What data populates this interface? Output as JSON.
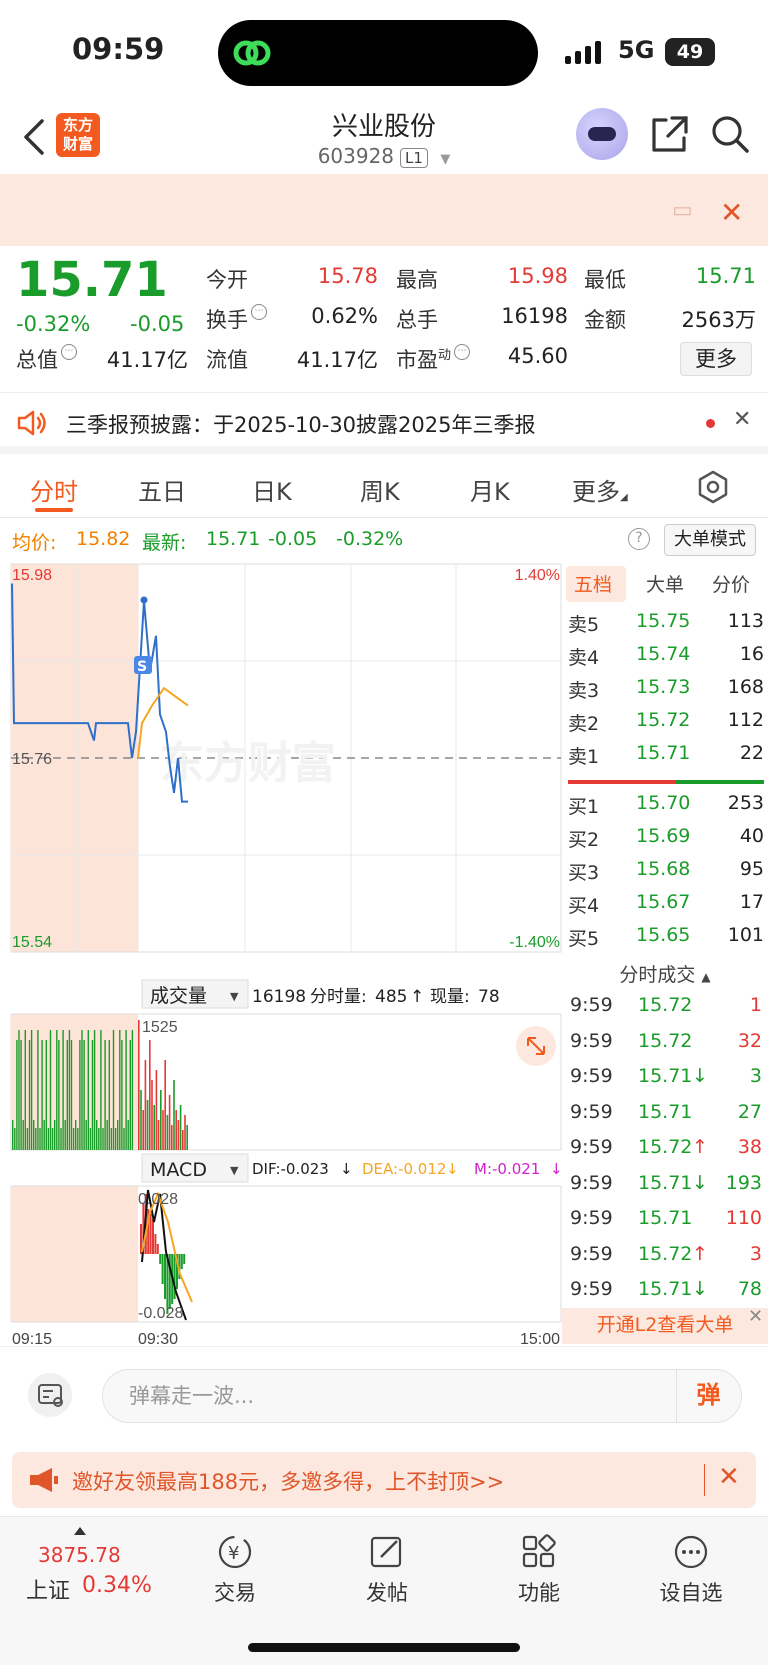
{
  "status_bar": {
    "time": "09:59",
    "network": "5G",
    "battery": "49"
  },
  "header": {
    "logo_text": "东方财富",
    "stock_name": "兴业股份",
    "stock_code": "603928",
    "level": "L1"
  },
  "quote": {
    "price": "15.71",
    "change_pct": "-0.32%",
    "change_amt": "-0.05",
    "fields": {
      "open_label": "今开",
      "open": "15.78",
      "high_label": "最高",
      "high": "15.98",
      "low_label": "最低",
      "low": "15.71",
      "turnover_label": "换手",
      "turnover": "0.62%",
      "volume_label": "总手",
      "volume": "16198",
      "amount_label": "金额",
      "amount": "2563万",
      "mktcap_label": "总值",
      "mktcap": "41.17亿",
      "float_label": "流值",
      "float": "41.17亿",
      "pe_label": "市盈",
      "pe_sup": "动",
      "pe": "45.60"
    },
    "more_label": "更多"
  },
  "notice": {
    "text": "三季报预披露：于2025-10-30披露2025年三季报"
  },
  "tabs": [
    "分时",
    "五日",
    "日K",
    "周K",
    "月K",
    "更多"
  ],
  "active_tab": 0,
  "info": {
    "avg_label": "均价:",
    "avg": "15.82",
    "latest_label": "最新:",
    "latest": "15.71",
    "latest_chg": "-0.05",
    "latest_pct": "-0.32%",
    "big_order_btn": "大单模式"
  },
  "chart": {
    "price_high": "15.98",
    "price_low": "15.54",
    "pct_high": "1.40%",
    "pct_low": "-1.40%",
    "prev_close": "15.76",
    "watermark": "东方财富",
    "volume_selector": "成交量",
    "volume_total": "16198",
    "volume_info_label": "分时量:",
    "volume_info": "485",
    "volume_now_label": "现量:",
    "volume_now": "78",
    "volume_max": "1525",
    "macd_selector": "MACD",
    "dif": "DIF:-0.023",
    "dea": "DEA:-0.012",
    "m": "M:-0.021",
    "macd_high": "0.028",
    "macd_low": "-0.028",
    "time_start": "09:15",
    "time_mid": "09:30",
    "time_end": "15:00"
  },
  "order_book": {
    "tabs": [
      "五档",
      "大单",
      "分价"
    ],
    "asks": [
      {
        "label": "卖5",
        "price": "15.75",
        "vol": "113"
      },
      {
        "label": "卖4",
        "price": "15.74",
        "vol": "16"
      },
      {
        "label": "卖3",
        "price": "15.73",
        "vol": "168"
      },
      {
        "label": "卖2",
        "price": "15.72",
        "vol": "112"
      },
      {
        "label": "卖1",
        "price": "15.71",
        "vol": "22"
      }
    ],
    "bids": [
      {
        "label": "买1",
        "price": "15.70",
        "vol": "253"
      },
      {
        "label": "买2",
        "price": "15.69",
        "vol": "40"
      },
      {
        "label": "买3",
        "price": "15.68",
        "vol": "95"
      },
      {
        "label": "买4",
        "price": "15.67",
        "vol": "17"
      },
      {
        "label": "买5",
        "price": "15.65",
        "vol": "101"
      }
    ]
  },
  "ticks": {
    "header": "分时成交",
    "rows": [
      {
        "time": "9:59",
        "price": "15.72",
        "arrow": "",
        "vol": "1",
        "color": "#e53935"
      },
      {
        "time": "9:59",
        "price": "15.72",
        "arrow": "",
        "vol": "32",
        "color": "#e53935"
      },
      {
        "time": "9:59",
        "price": "15.71",
        "arrow": "↓",
        "vol": "3",
        "color": "#1a9c2a"
      },
      {
        "time": "9:59",
        "price": "15.71",
        "arrow": "",
        "vol": "27",
        "color": "#1a9c2a"
      },
      {
        "time": "9:59",
        "price": "15.72",
        "arrow": "↑",
        "vol": "38",
        "color": "#e53935"
      },
      {
        "time": "9:59",
        "price": "15.71",
        "arrow": "↓",
        "vol": "193",
        "color": "#1a9c2a"
      },
      {
        "time": "9:59",
        "price": "15.71",
        "arrow": "",
        "vol": "110",
        "color": "#e53935"
      },
      {
        "time": "9:59",
        "price": "15.72",
        "arrow": "↑",
        "vol": "3",
        "color": "#e53935"
      },
      {
        "time": "9:59",
        "price": "15.71",
        "arrow": "↓",
        "vol": "78",
        "color": "#1a9c2a"
      }
    ],
    "l2_promo": "开通L2查看大单"
  },
  "comment": {
    "placeholder": "弹幕走一波...",
    "danmu": "弹"
  },
  "invite": {
    "text": "邀好友领最高188元，多邀多得，上不封顶>>"
  },
  "bottom_nav": {
    "index_value": "3875.78",
    "index_name": "上证",
    "index_pct": "0.34%",
    "items": [
      "交易",
      "发帖",
      "功能",
      "设自选"
    ]
  },
  "colors": {
    "up": "#e53935",
    "down": "#1a9c2a",
    "accent": "#f25a1f",
    "avg_line": "#f5a623",
    "price_line": "#2f6fc9"
  },
  "chart_data": {
    "type": "line",
    "title": "",
    "ylim": [
      15.54,
      15.98
    ],
    "prev_close": 15.76,
    "x": [
      "09:15",
      "09:30",
      "15:00"
    ],
    "series": [
      {
        "name": "最新",
        "values": [
          15.96,
          15.8,
          15.8,
          15.8,
          15.8,
          15.8,
          15.78,
          15.8,
          15.8,
          15.8,
          15.76,
          15.79,
          15.94,
          15.86,
          15.9,
          15.81,
          15.79,
          15.75,
          15.72,
          15.76,
          15.71,
          15.71
        ]
      },
      {
        "name": "均价",
        "values": [
          15.76,
          15.8,
          15.82,
          15.84,
          15.83,
          15.82
        ]
      }
    ]
  }
}
